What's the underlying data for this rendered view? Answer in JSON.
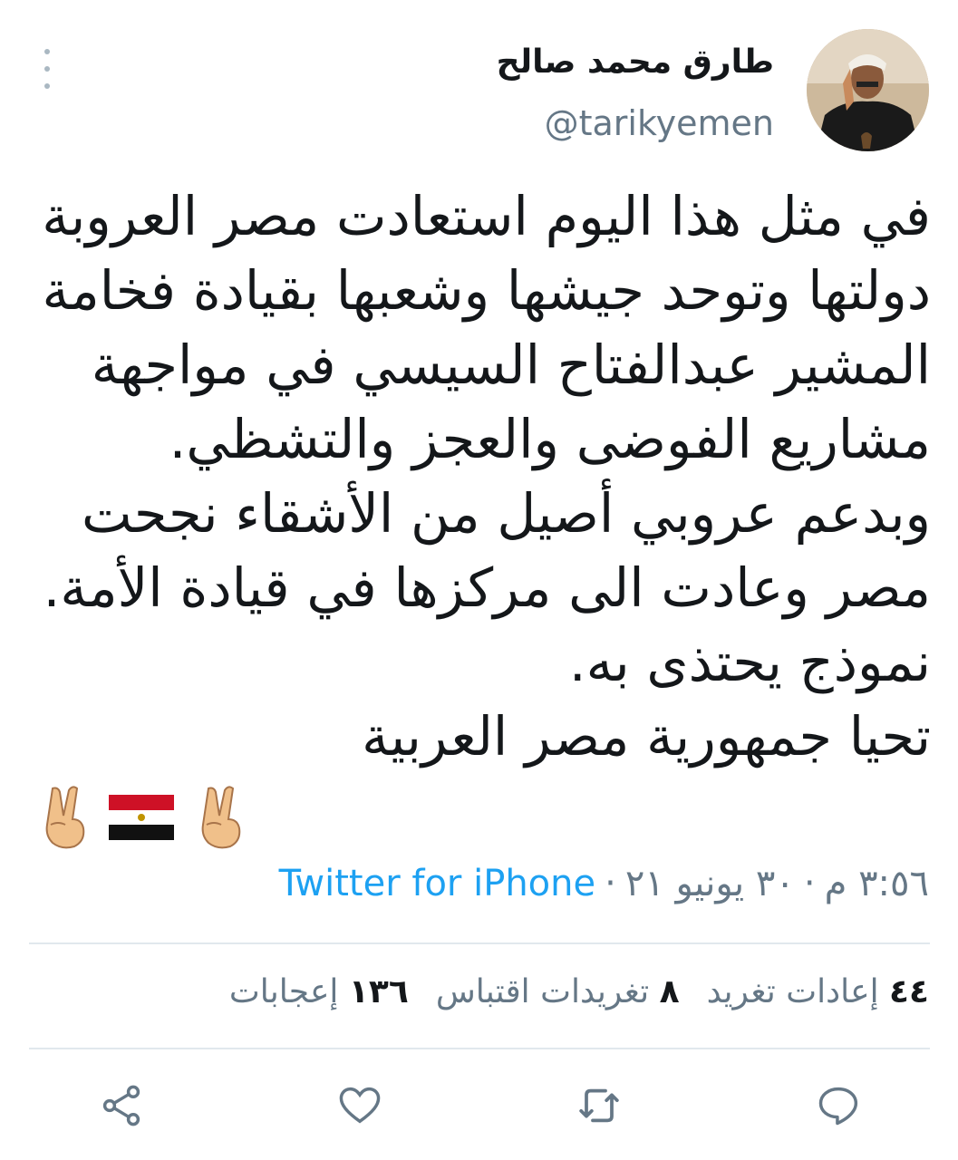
{
  "author": {
    "display_name": "طارق محمد صالح",
    "handle": "@tarikyemen"
  },
  "tweet": {
    "lines": [
      "في مثل هذا اليوم استعادت مصر العروبة",
      "دولتها وتوحد جيشها وشعبها بقيادة فخامة",
      "المشير عبدالفتاح السيسي في مواجهة",
      "مشاريع الفوضى والعجز والتشظي.",
      "وبدعم عروبي أصيل من الأشقاء نجحت",
      "مصر وعادت الى مركزها في قيادة الأمة.",
      "نموذج يحتذى به.",
      "تحيا جمهورية مصر العربية"
    ],
    "emojis": [
      "victory-hand",
      "egypt-flag",
      "victory-hand"
    ]
  },
  "meta": {
    "time": "٣:٥٦ م",
    "date": "٣٠ يونيو ٢١",
    "separator": "·",
    "source": "Twitter for iPhone"
  },
  "stats": {
    "retweets": {
      "count": "٤٤",
      "label": "إعادات تغريد"
    },
    "quotes": {
      "count": "٨",
      "label": "تغريدات اقتباس"
    },
    "likes": {
      "count": "١٣٦",
      "label": "إعجابات"
    }
  },
  "colors": {
    "text": "#14171a",
    "muted": "#657786",
    "accent": "#1da1f2",
    "divider": "#e1e8ed"
  },
  "icons": {
    "reply": "reply-icon",
    "retweet": "retweet-icon",
    "like": "heart-icon",
    "share": "share-icon",
    "more": "more-vertical-icon"
  }
}
